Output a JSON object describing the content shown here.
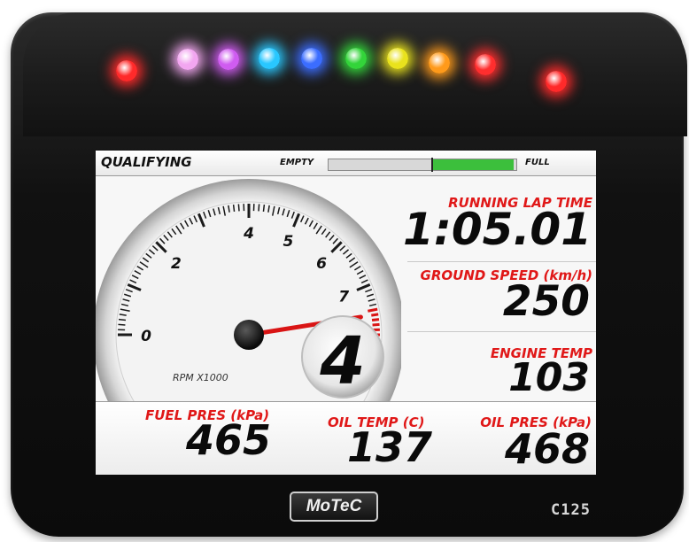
{
  "device": {
    "brand": "MoTeC",
    "model": "C125"
  },
  "shift_lights": {
    "colors": [
      "#ff2a2a",
      "#f2a6f0",
      "#cf5cf0",
      "#29c7ff",
      "#3b6dff",
      "#33d43a",
      "#e9e21d",
      "#ff9a1a",
      "#ff2e2e",
      "#ff2a2a"
    ]
  },
  "header": {
    "session": "QUALIFYING",
    "fuel_empty_label": "EMPTY",
    "fuel_full_label": "FULL",
    "fuel_level_fraction": 0.48
  },
  "gauge": {
    "unit_label": "RPM X1000",
    "tick_labels": [
      "0",
      "2",
      "4",
      "5",
      "6",
      "7",
      "8"
    ],
    "needle_rpm": 7.6,
    "redline_start_rpm": 7.5,
    "max_rpm": 8
  },
  "gear": {
    "value": "4"
  },
  "readouts": {
    "running_lap_time": {
      "label": "RUNNING LAP TIME",
      "value": "1:05.01"
    },
    "ground_speed": {
      "label": "GROUND SPEED (km/h)",
      "value": "250"
    },
    "engine_temp": {
      "label": "ENGINE TEMP",
      "value": "103"
    },
    "fuel_pres": {
      "label": "FUEL PRES (kPa)",
      "value": "465"
    },
    "oil_temp": {
      "label": "OIL TEMP (C)",
      "value": "137"
    },
    "oil_pres": {
      "label": "OIL PRES (kPa)",
      "value": "468"
    }
  },
  "colors": {
    "label_red": "#e01818",
    "needle_red": "#d91414",
    "fuel_green": "#3cbf3c"
  }
}
